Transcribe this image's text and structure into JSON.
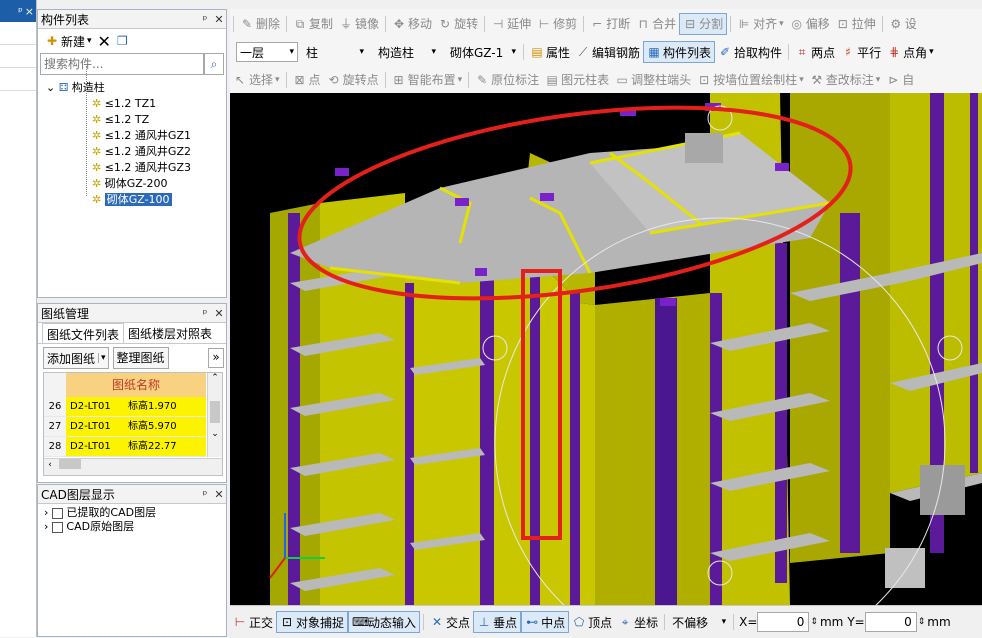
{
  "components_panel": {
    "title": "构件列表",
    "new_label": "新建",
    "search_placeholder": "搜索构件...",
    "tree_root": "构造柱",
    "tree_items": [
      "≤1.2 TZ1",
      "≤1.2 TZ",
      "≤1.2 通风井GZ1",
      "≤1.2 通风井GZ2",
      "≤1.2 通风井GZ3",
      "砌体GZ-200",
      "砌体GZ-100"
    ],
    "selected_index": 6
  },
  "drawings_panel": {
    "title": "图纸管理",
    "tabs": [
      "图纸文件列表",
      "图纸楼层对照表"
    ],
    "add_label": "添加图纸",
    "organize_label": "整理图纸",
    "column_header": "图纸名称",
    "rows": [
      {
        "num": "26",
        "name": "D2-LT01",
        "elev": "标高1.970"
      },
      {
        "num": "27",
        "name": "D2-LT01",
        "elev": "标高5.970"
      },
      {
        "num": "28",
        "name": "D2-LT01",
        "elev": "标高22.77"
      }
    ]
  },
  "cad_panel": {
    "title": "CAD图层显示",
    "items": [
      "已提取的CAD图层",
      "CAD原始图层"
    ]
  },
  "toolbar1": [
    "删除",
    "复制",
    "镜像",
    "移动",
    "旋转",
    "延伸",
    "修剪",
    "打断",
    "合并",
    "分割",
    "对齐",
    "偏移",
    "拉伸",
    "设"
  ],
  "toolbar2": {
    "floor": "一层",
    "type": "柱",
    "subtype": "构造柱",
    "component": "砌体GZ-1",
    "buttons": [
      "属性",
      "编辑钢筋",
      "构件列表",
      "拾取构件",
      "两点",
      "平行",
      "点角"
    ]
  },
  "toolbar3": [
    "选择",
    "点",
    "旋转点",
    "智能布置",
    "原位标注",
    "图元柱表",
    "调整柱端头",
    "按墙位置绘制柱",
    "查改标注",
    "自"
  ],
  "status_bar": {
    "items": [
      "正交",
      "对象捕捉",
      "动态输入",
      "交点",
      "垂点",
      "中点",
      "顶点",
      "坐标"
    ],
    "offset_mode": "不偏移",
    "x_label": "X=",
    "x_value": "0",
    "y_label": "Y=",
    "y_value": "0",
    "unit": "mm"
  }
}
